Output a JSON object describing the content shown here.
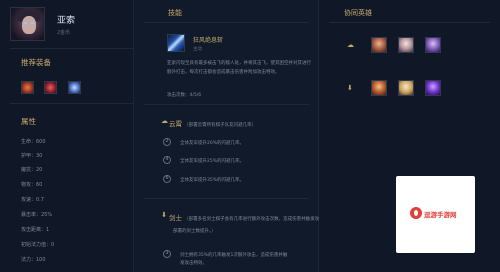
{
  "hero": {
    "name": "亚索",
    "price": "2金币"
  },
  "left": {
    "items_title": "推荐装备",
    "items": [
      {
        "icon": "flame-item-icon"
      },
      {
        "icon": "blade-item-icon"
      },
      {
        "icon": "frost-item-icon"
      }
    ],
    "attributes_title": "属性",
    "attributes": [
      "生命：600",
      "护甲：30",
      "魔抗：20",
      "物攻：60",
      "攻速：0.7",
      "暴击率：25%",
      "攻击距离：1",
      "初始法力值：0",
      "法力：100"
    ]
  },
  "skill": {
    "section_title": "技能",
    "name": "狂风绝息斩",
    "type": "主动",
    "description": "亚索闪现至具有最多被击飞的敌人处，并将其击飞，使其困空并对其进行额外打击，每次打击都会造成暴击伤害并附加攻击特效。",
    "cooldown": "攻击次数：4/5/6"
  },
  "talents": [
    {
      "name": "云霄",
      "note": "（部署云霄所有棋子队友闪避几率）",
      "tiers": [
        {
          "num": "2",
          "text": "全体友军提升20%的闪避几率。"
        },
        {
          "num": "4",
          "text": "全体友军提升25%的闪避几率。"
        },
        {
          "num": "6",
          "text": "全体友军提升35%的闪避几率。"
        }
      ]
    },
    {
      "name": "剑士",
      "note": "（部署多名剑士棋子会有几率进行额外攻击次数，造成伤害并触发攻击特效，额外攻击次数",
      "note2": "部署的剑士数提升。）",
      "tiers": [
        {
          "num": "3",
          "text": "剑士拥有35%的几率触发1次额外攻击，造成伤害并触发攻击特效。"
        }
      ]
    }
  ],
  "synergy": {
    "section_title": "协同英雄",
    "rows": [
      {
        "icon": "cloud-icon",
        "champs": [
          "champion-1",
          "champion-2",
          "champion-3"
        ]
      },
      {
        "icon": "sword-icon",
        "champs": [
          "champion-4",
          "champion-5",
          "champion-6"
        ]
      }
    ]
  },
  "watermark": {
    "text": "逗游手游网",
    "color": "#e0403a"
  }
}
